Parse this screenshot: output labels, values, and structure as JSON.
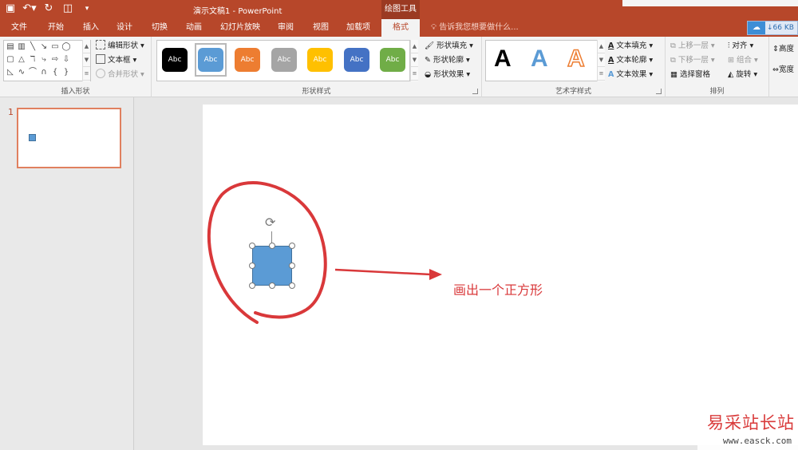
{
  "window": {
    "title": "演示文稿1 - PowerPoint",
    "context_tab_group": "绘图工具"
  },
  "tabs": [
    {
      "label": "文件"
    },
    {
      "label": "开始"
    },
    {
      "label": "插入"
    },
    {
      "label": "设计"
    },
    {
      "label": "切换"
    },
    {
      "label": "动画"
    },
    {
      "label": "幻灯片放映"
    },
    {
      "label": "审阅"
    },
    {
      "label": "视图"
    },
    {
      "label": "加载项"
    },
    {
      "label": "格式"
    }
  ],
  "active_tab": "格式",
  "tell_me": "告诉我您想要做什么...",
  "account": {
    "size": "66 KB"
  },
  "ribbon": {
    "insert_shapes": {
      "label": "插入形状",
      "edit_shape": "编辑形状",
      "text_box": "文本框",
      "merge_shapes": "合并形状"
    },
    "shape_styles": {
      "label": "形状样式",
      "swatches": [
        {
          "text": "Abc",
          "color": "#000000"
        },
        {
          "text": "Abc",
          "color": "#5b9bd5"
        },
        {
          "text": "Abc",
          "color": "#ed7d31"
        },
        {
          "text": "Abc",
          "color": "#a5a5a5"
        },
        {
          "text": "Abc",
          "color": "#ffc000"
        },
        {
          "text": "Abc",
          "color": "#4472c4"
        },
        {
          "text": "Abc",
          "color": "#70ad47"
        }
      ],
      "fill": "形状填充",
      "outline": "形状轮廓",
      "effects": "形状效果"
    },
    "wordart": {
      "label": "艺术字样式",
      "sample": "A",
      "text_fill": "文本填充",
      "text_outline": "文本轮廓",
      "text_effects": "文本效果"
    },
    "arrange": {
      "label": "排列",
      "bring_forward": "上移一层",
      "send_backward": "下移一层",
      "selection_pane": "选择窗格",
      "align": "对齐",
      "group": "组合",
      "rotate": "旋转"
    },
    "size": {
      "height": "高度",
      "width": "宽度"
    }
  },
  "slides_panel": {
    "slide_number": "1"
  },
  "annotation": {
    "text": "画出一个正方形",
    "color": "#d9383a"
  },
  "shape": {
    "fill": "#5b9bd5",
    "border": "#41719c"
  },
  "watermark": {
    "main": "易采站长站",
    "url": "www.easck.com"
  }
}
